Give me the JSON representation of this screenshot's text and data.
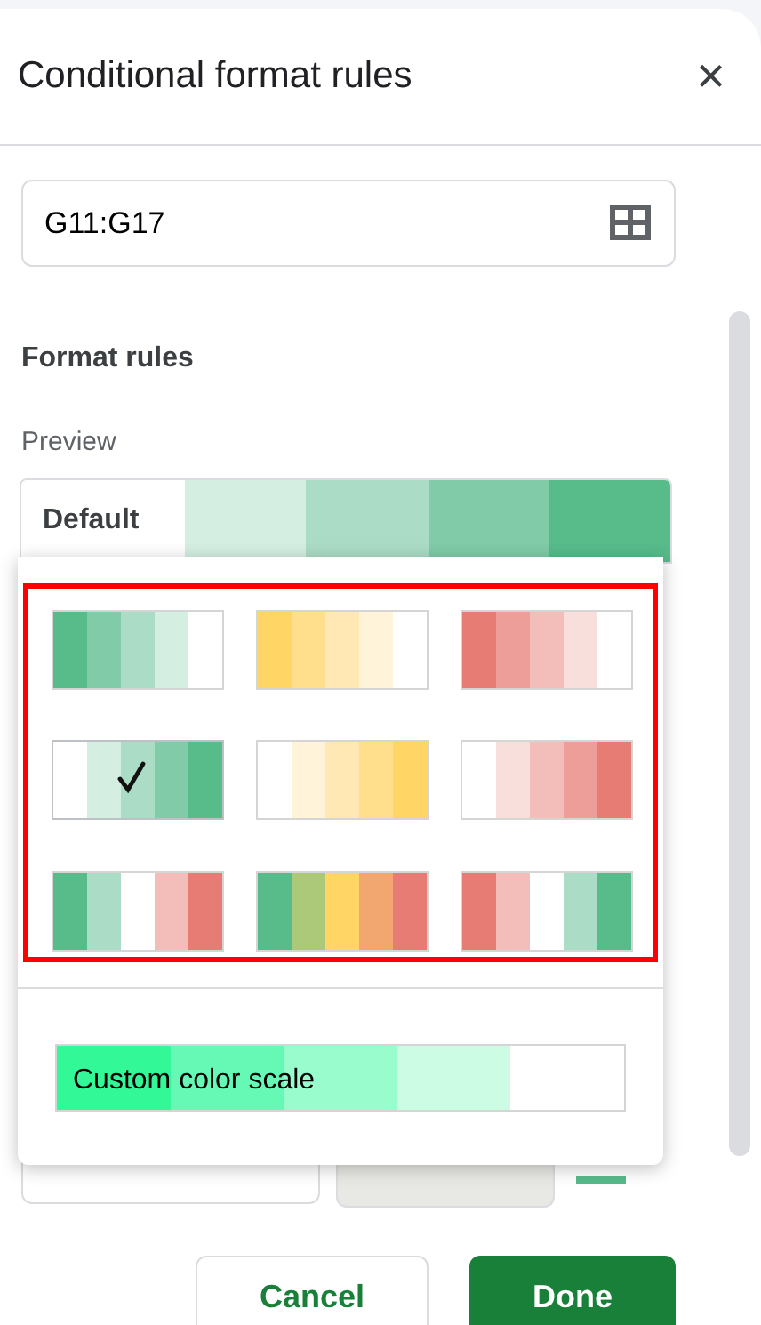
{
  "panel": {
    "title": "Conditional format rules",
    "close": "×"
  },
  "range": {
    "value": "G11:G17"
  },
  "section": "Format rules",
  "preview": {
    "label": "Preview",
    "text": "Default",
    "swatches": [
      {
        "color": "#ffffff"
      },
      {
        "color": "#d5eee2"
      },
      {
        "color": "#abdcc5"
      },
      {
        "color": "#81cba8"
      },
      {
        "color": "#57bb8a"
      }
    ]
  },
  "palettes": [
    {
      "swatches": [
        {
          "color": "#57bb8a"
        },
        {
          "color": "#81cba8"
        },
        {
          "color": "#abdcc5"
        },
        {
          "color": "#d5eee2"
        },
        {
          "color": "#ffffff"
        }
      ],
      "selected": false
    },
    {
      "swatches": [
        {
          "color": "#ffd666"
        },
        {
          "color": "#ffdf8c"
        },
        {
          "color": "#ffe8b3"
        },
        {
          "color": "#fff4d9"
        },
        {
          "color": "#ffffff"
        }
      ],
      "selected": false
    },
    {
      "swatches": [
        {
          "color": "#e67c73"
        },
        {
          "color": "#ed9e98"
        },
        {
          "color": "#f3beba"
        },
        {
          "color": "#f9dfdc"
        },
        {
          "color": "#ffffff"
        }
      ],
      "selected": false
    },
    {
      "swatches": [
        {
          "color": "#ffffff"
        },
        {
          "color": "#d5eee2"
        },
        {
          "color": "#abdcc5"
        },
        {
          "color": "#81cba8"
        },
        {
          "color": "#57bb8a"
        }
      ],
      "selected": true
    },
    {
      "swatches": [
        {
          "color": "#ffffff"
        },
        {
          "color": "#fff4d9"
        },
        {
          "color": "#ffe8b3"
        },
        {
          "color": "#ffdf8c"
        },
        {
          "color": "#ffd666"
        }
      ],
      "selected": false
    },
    {
      "swatches": [
        {
          "color": "#ffffff"
        },
        {
          "color": "#f9dfdc"
        },
        {
          "color": "#f3beba"
        },
        {
          "color": "#ed9e98"
        },
        {
          "color": "#e67c73"
        }
      ],
      "selected": false
    },
    {
      "swatches": [
        {
          "color": "#57bb8a"
        },
        {
          "color": "#abdcc5"
        },
        {
          "color": "#ffffff"
        },
        {
          "color": "#f3beba"
        },
        {
          "color": "#e67c73"
        }
      ],
      "selected": false
    },
    {
      "swatches": [
        {
          "color": "#57bb8a"
        },
        {
          "color": "#abc978"
        },
        {
          "color": "#ffd666"
        },
        {
          "color": "#f1a76f"
        },
        {
          "color": "#e67c73"
        }
      ],
      "selected": false
    },
    {
      "swatches": [
        {
          "color": "#e67c73"
        },
        {
          "color": "#f3beba"
        },
        {
          "color": "#ffffff"
        },
        {
          "color": "#abdcc5"
        },
        {
          "color": "#57bb8a"
        }
      ],
      "selected": false
    }
  ],
  "custom": {
    "text": "Custom color scale",
    "swatches": [
      {
        "color": "#33f898"
      },
      {
        "color": "#66f9b6"
      },
      {
        "color": "#99fccc"
      },
      {
        "color": "#ccfce4"
      },
      {
        "color": "#ffffff"
      }
    ]
  },
  "buttons": [
    {
      "label": "Cancel",
      "kind": "secondary"
    },
    {
      "label": "Done",
      "kind": "primary"
    }
  ]
}
